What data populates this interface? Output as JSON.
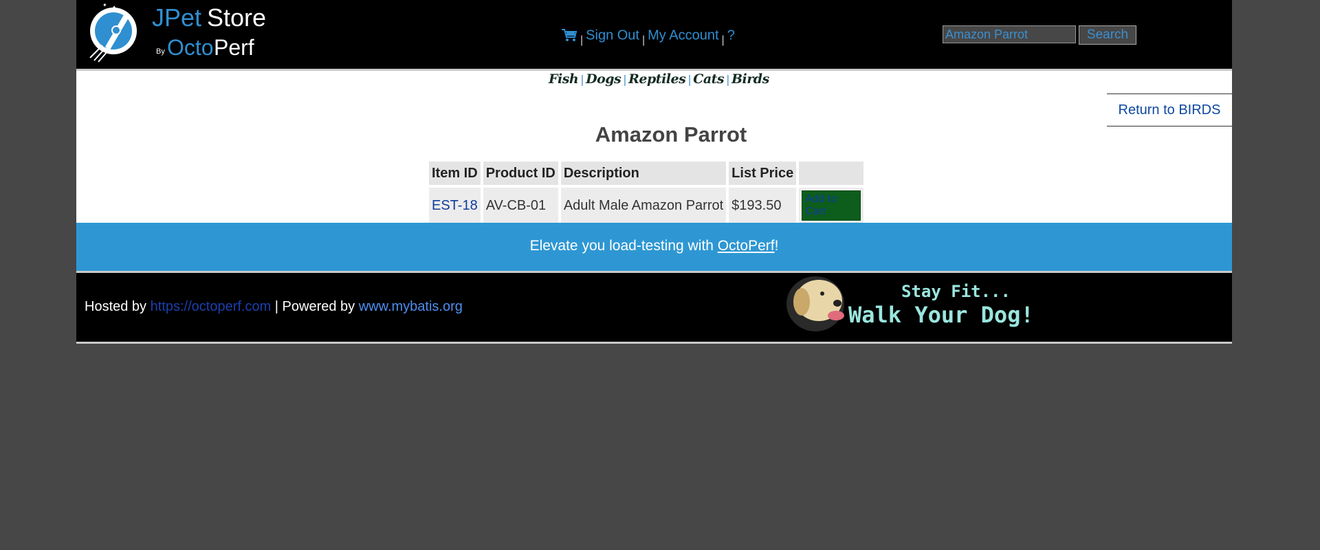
{
  "header": {
    "logo": {
      "line1": "JPet",
      "line1b": "Store",
      "by": "By",
      "octo": "Octo",
      "perf": "Perf"
    },
    "menu": {
      "cart_icon": "cart-icon",
      "sign_out": "Sign Out",
      "my_account": "My Account",
      "help": "?"
    },
    "search": {
      "value": "Amazon Parrot",
      "button": "Search"
    }
  },
  "quicklinks": [
    "Fish",
    "Dogs",
    "Reptiles",
    "Cats",
    "Birds"
  ],
  "back_link": "Return to BIRDS",
  "product": {
    "title": "Amazon Parrot",
    "columns": [
      "Item ID",
      "Product ID",
      "Description",
      "List Price",
      ""
    ],
    "rows": [
      {
        "item_id": "EST-18",
        "product_id": "AV-CB-01",
        "description": "Adult Male Amazon Parrot",
        "price": "$193.50",
        "action": "Add to Cart"
      }
    ]
  },
  "promo": {
    "prefix": "Elevate you load-testing with ",
    "link": "OctoPerf",
    "suffix": "!"
  },
  "footer": {
    "hosted_prefix": "Hosted by ",
    "hosted_link": "https://octoperf.com",
    "powered_prefix": " | Powered by ",
    "powered_link": "www.mybatis.org",
    "banner": {
      "line1": "Stay Fit...",
      "line2": "Walk Your Dog!"
    }
  },
  "colors": {
    "accent": "#2e97d3",
    "link": "#0e48a0",
    "cart_button": "#0d5d1d",
    "page_bg": "#474747"
  }
}
